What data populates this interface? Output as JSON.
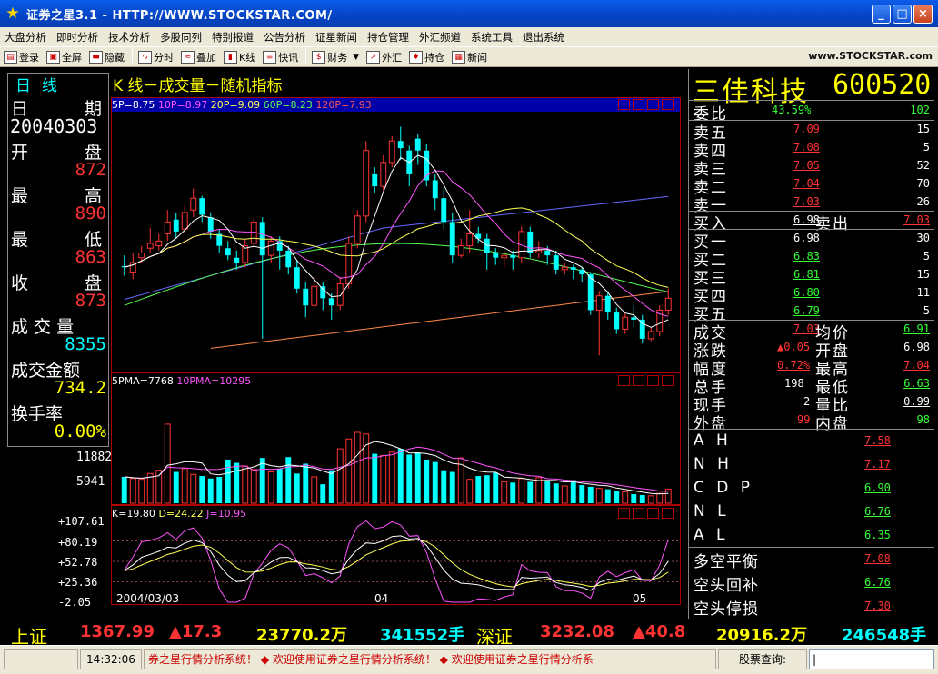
{
  "window": {
    "title": "证券之星3.1 - HTTP://WWW.STOCKSTAR.COM/",
    "minimize": "_",
    "maximize": "□",
    "close": "×"
  },
  "menu": [
    "大盘分析",
    "即时分析",
    "技术分析",
    "多股同列",
    "特别报道",
    "公告分析",
    "证星新闻",
    "持仓管理",
    "外汇频道",
    "系统工具",
    "退出系统"
  ],
  "toolbar": {
    "items": [
      "登录",
      "全屏",
      "隐藏",
      "分时",
      "叠加",
      "K线",
      "快讯",
      "财务",
      "外汇",
      "持仓",
      "新闻"
    ],
    "logo": "www.STOCKSTAR.com"
  },
  "left_panel": {
    "tab": "日线",
    "date_label": [
      "日",
      "期"
    ],
    "date_value": "20040303",
    "open_label": [
      "开",
      "盘"
    ],
    "open_value": "872",
    "high_label": [
      "最",
      "高"
    ],
    "high_value": "890",
    "low_label": [
      "最",
      "低"
    ],
    "low_value": "863",
    "close_label": [
      "收",
      "盘"
    ],
    "close_value": "873",
    "volume_label": "成 交 量",
    "volume_value": "8355",
    "amount_label": "成交金额",
    "amount_value": "734.2",
    "turnover_label": "换手率",
    "turnover_value": "0.00%"
  },
  "chart_title": "K 线－成交量－随机指标",
  "kline_panel": {
    "ma_labels": [
      {
        "label": "5P=",
        "value": "8.75",
        "color": "#ffffff"
      },
      {
        "label": "10P=",
        "value": "8.97",
        "color": "#ff55ff"
      },
      {
        "label": "20P=",
        "value": "9.09",
        "color": "#ffff55"
      },
      {
        "label": "60P=",
        "value": "8.23",
        "color": "#55ff55"
      },
      {
        "label": "120P=",
        "value": "7.93",
        "color": "#ff5555"
      }
    ]
  },
  "volume_panel": {
    "ma_labels": [
      {
        "label": "5PMA=",
        "value": "7768",
        "color": "#ffffff"
      },
      {
        "label": "10PMA=",
        "value": "10295",
        "color": "#ff55ff"
      }
    ],
    "axis": [
      "11882",
      "5941"
    ]
  },
  "kdj_panel": {
    "labels": [
      {
        "label": "K=",
        "value": "19.80",
        "color": "#ffffff"
      },
      {
        "label": "D=",
        "value": "24.22",
        "color": "#ffff55"
      },
      {
        "label": "J=",
        "value": "10.95",
        "color": "#ff55ff"
      }
    ],
    "axis": [
      "+107.61",
      "+80.19",
      "+52.78",
      "+25.36",
      "-2.05"
    ]
  },
  "x_axis": [
    "2004/03/03",
    "04",
    "05"
  ],
  "chart_data": {
    "type": "candlestick",
    "candles": [
      [
        8.63,
        8.62,
        8.72,
        8.55
      ],
      [
        8.58,
        8.66,
        8.74,
        8.52
      ],
      [
        8.7,
        8.74,
        8.8,
        8.66
      ],
      [
        8.78,
        8.82,
        8.95,
        8.74
      ],
      [
        8.8,
        8.84,
        8.9,
        8.76
      ],
      [
        8.9,
        9.0,
        9.1,
        8.84
      ],
      [
        9.02,
        8.92,
        9.08,
        8.86
      ],
      [
        8.94,
        9.08,
        9.14,
        8.9
      ],
      [
        9.1,
        9.2,
        9.28,
        9.04
      ],
      [
        9.2,
        9.06,
        9.22,
        9.0
      ],
      [
        9.04,
        8.92,
        9.08,
        8.86
      ],
      [
        8.9,
        8.8,
        8.94,
        8.74
      ],
      [
        8.78,
        8.72,
        8.84,
        8.68
      ],
      [
        8.7,
        8.66,
        8.76,
        8.6
      ],
      [
        8.66,
        8.8,
        8.86,
        8.62
      ],
      [
        8.82,
        9.0,
        9.04,
        8.78
      ],
      [
        9.0,
        8.72,
        9.04,
        8.02
      ],
      [
        8.72,
        8.84,
        8.88,
        8.66
      ],
      [
        8.84,
        8.76,
        8.88,
        8.6
      ],
      [
        8.76,
        8.62,
        8.8,
        8.56
      ],
      [
        8.62,
        8.44,
        8.68,
        8.4
      ],
      [
        8.44,
        8.3,
        8.5,
        8.2
      ],
      [
        8.3,
        8.46,
        8.54,
        8.28
      ],
      [
        8.46,
        8.36,
        8.5,
        8.26
      ],
      [
        8.36,
        8.3,
        8.4,
        8.18
      ],
      [
        8.3,
        8.48,
        8.54,
        8.26
      ],
      [
        8.48,
        8.82,
        8.88,
        8.44
      ],
      [
        8.82,
        9.05,
        9.1,
        8.78
      ],
      [
        9.05,
        9.6,
        9.68,
        9.0
      ],
      [
        9.4,
        9.3,
        9.46,
        9.24
      ],
      [
        9.3,
        9.5,
        9.56,
        9.26
      ],
      [
        9.5,
        9.68,
        9.72,
        9.46
      ],
      [
        9.68,
        9.62,
        9.8,
        9.52
      ],
      [
        9.6,
        9.4,
        9.64,
        9.3
      ],
      [
        9.7,
        9.6,
        9.74,
        9.48
      ],
      [
        9.6,
        9.35,
        9.66,
        9.3
      ],
      [
        9.35,
        9.2,
        9.4,
        9.1
      ],
      [
        9.2,
        9.0,
        9.28,
        8.94
      ],
      [
        9.0,
        8.72,
        9.08,
        8.66
      ],
      [
        8.72,
        8.8,
        8.86,
        8.7
      ],
      [
        8.8,
        8.9,
        9.1,
        8.74
      ],
      [
        8.9,
        8.86,
        8.96,
        8.82
      ],
      [
        8.86,
        8.74,
        8.9,
        8.6
      ],
      [
        8.74,
        8.7,
        8.78,
        8.64
      ],
      [
        8.7,
        8.72,
        8.76,
        8.62
      ],
      [
        8.72,
        8.7,
        8.76,
        8.6
      ],
      [
        8.7,
        8.92,
        8.96,
        8.66
      ],
      [
        8.92,
        8.74,
        8.96,
        8.7
      ],
      [
        8.74,
        8.76,
        8.84,
        8.7
      ],
      [
        8.76,
        8.72,
        8.8,
        8.64
      ],
      [
        8.72,
        8.6,
        8.76,
        8.56
      ],
      [
        8.6,
        8.62,
        8.66,
        8.56
      ],
      [
        8.62,
        8.6,
        8.64,
        8.52
      ],
      [
        8.6,
        8.56,
        8.62,
        8.5
      ],
      [
        8.56,
        8.26,
        8.58,
        8.22
      ],
      [
        8.26,
        8.38,
        8.42,
        7.88
      ],
      [
        8.38,
        8.24,
        8.42,
        8.18
      ],
      [
        8.24,
        8.1,
        8.28,
        8.06
      ],
      [
        8.1,
        8.2,
        8.24,
        8.06
      ],
      [
        8.2,
        8.18,
        8.3,
        8.12
      ],
      [
        8.18,
        8.02,
        8.22,
        7.98
      ],
      [
        8.02,
        8.08,
        8.12,
        8.0
      ],
      [
        8.08,
        8.26,
        8.3,
        8.04
      ],
      [
        8.26,
        8.36,
        8.44,
        8.22
      ]
    ],
    "price_range": [
      7.76,
      9.88
    ],
    "volumes": [
      3200,
      3000,
      2900,
      3600,
      4000,
      9600,
      3800,
      4200,
      3500,
      3300,
      3000,
      3200,
      5300,
      4900,
      4500,
      4100,
      5500,
      3800,
      4200,
      5600,
      3600,
      4800,
      3200,
      2300,
      4000,
      6600,
      7800,
      8600,
      8400,
      6000,
      5800,
      6200,
      6600,
      5900,
      6100,
      5300,
      5000,
      4000,
      3800,
      5500,
      2900,
      3300,
      3400,
      3700,
      2600,
      2500,
      3000,
      2600,
      3100,
      2700,
      2400,
      2100,
      2800,
      2200,
      2000,
      1800,
      1700,
      1500,
      1400,
      1100,
      1000,
      900,
      1200,
      1700
    ],
    "volume_range": [
      0,
      14000
    ],
    "kdj_range": [
      -2.05,
      107.61
    ]
  },
  "right_panel": {
    "stock_name": "三佳科技",
    "stock_code": "600520",
    "ratio_label": "委比",
    "ratio_value": "43.59%",
    "ratio_vol": "102",
    "sells": [
      {
        "label": "卖五",
        "price": "7.09",
        "vol": "15"
      },
      {
        "label": "卖四",
        "price": "7.08",
        "vol": "5"
      },
      {
        "label": "卖三",
        "price": "7.05",
        "vol": "52"
      },
      {
        "label": "卖二",
        "price": "7.04",
        "vol": "70"
      },
      {
        "label": "卖一",
        "price": "7.03",
        "vol": "26"
      }
    ],
    "buyin_label": "买入",
    "buyin_value": "6.98",
    "sellout_label": "卖出",
    "sellout_value": "7.03",
    "buys": [
      {
        "label": "买一",
        "price": "6.98",
        "vol": "30"
      },
      {
        "label": "买二",
        "price": "6.83",
        "vol": "5"
      },
      {
        "label": "买三",
        "price": "6.81",
        "vol": "15"
      },
      {
        "label": "买四",
        "price": "6.80",
        "vol": "11"
      },
      {
        "label": "买五",
        "price": "6.79",
        "vol": "5"
      }
    ],
    "stats": [
      {
        "l1": "成交",
        "v1": "7.03",
        "c1": "#ff3333",
        "l2": "均价",
        "v2": "6.91",
        "c2": "#33ff33"
      },
      {
        "l1": "涨跌",
        "v1": "▲0.05",
        "c1": "#ff3333",
        "l2": "开盘",
        "v2": "6.98",
        "c2": "#ffffff"
      },
      {
        "l1": "幅度",
        "v1": "0.72%",
        "c1": "#ff3333",
        "l2": "最高",
        "v2": "7.04",
        "c2": "#ff3333"
      },
      {
        "l1": "总手",
        "v1": "198",
        "c1": "#ffffff",
        "l2": "最低",
        "v2": "6.63",
        "c2": "#33ff33"
      },
      {
        "l1": "现手",
        "v1": "2",
        "c1": "#ffffff",
        "l2": "量比",
        "v2": "0.99",
        "c2": "#ffffff"
      },
      {
        "l1": "外盘",
        "v1": "99",
        "c1": "#ff3333",
        "l2": "内盘",
        "v2": "98",
        "c2": "#33ff33"
      }
    ],
    "tech": [
      {
        "label": "A H",
        "value": "7.58",
        "color": "#ff3333"
      },
      {
        "label": "N H",
        "value": "7.17",
        "color": "#ff3333"
      },
      {
        "label": "C D P",
        "value": "6.90",
        "color": "#33ff33"
      },
      {
        "label": "N L",
        "value": "6.76",
        "color": "#33ff33"
      },
      {
        "label": "A L",
        "value": "6.35",
        "color": "#33ff33"
      }
    ],
    "signals": [
      {
        "label": "多空平衡",
        "value": "7.08",
        "color": "#ff3333"
      },
      {
        "label": "空头回补",
        "value": "6.76",
        "color": "#33ff33"
      },
      {
        "label": "空头停损",
        "value": "7.30",
        "color": "#ff3333"
      }
    ]
  },
  "index_bar": {
    "sh_label": "上证",
    "sh_value": "1367.99",
    "sh_change": "▲17.3",
    "sh_amount": "23770.2万",
    "sh_volume": "341552手",
    "sz_label": "深证",
    "sz_value": "3232.08",
    "sz_change": "▲40.8",
    "sz_amount": "20916.2万",
    "sz_volume": "246548手"
  },
  "status_bar": {
    "time": "14:32:06",
    "ticker": "券之星行情分析系统！ ◆ 欢迎使用证券之星行情分析系统！ ◆ 欢迎使用证券之星行情分析系",
    "query_label": "股票查询:"
  }
}
